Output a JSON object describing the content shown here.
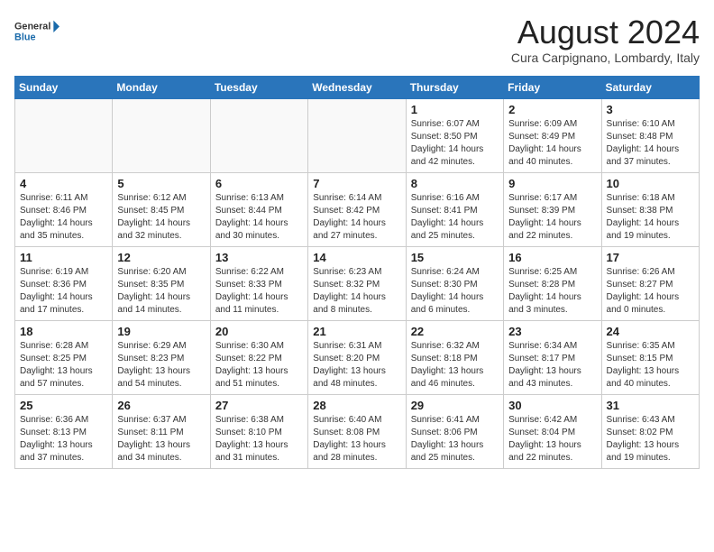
{
  "header": {
    "logo_general": "General",
    "logo_blue": "Blue",
    "month_title": "August 2024",
    "location": "Cura Carpignano, Lombardy, Italy"
  },
  "weekdays": [
    "Sunday",
    "Monday",
    "Tuesday",
    "Wednesday",
    "Thursday",
    "Friday",
    "Saturday"
  ],
  "weeks": [
    [
      {
        "day": "",
        "info": ""
      },
      {
        "day": "",
        "info": ""
      },
      {
        "day": "",
        "info": ""
      },
      {
        "day": "",
        "info": ""
      },
      {
        "day": "1",
        "info": "Sunrise: 6:07 AM\nSunset: 8:50 PM\nDaylight: 14 hours\nand 42 minutes."
      },
      {
        "day": "2",
        "info": "Sunrise: 6:09 AM\nSunset: 8:49 PM\nDaylight: 14 hours\nand 40 minutes."
      },
      {
        "day": "3",
        "info": "Sunrise: 6:10 AM\nSunset: 8:48 PM\nDaylight: 14 hours\nand 37 minutes."
      }
    ],
    [
      {
        "day": "4",
        "info": "Sunrise: 6:11 AM\nSunset: 8:46 PM\nDaylight: 14 hours\nand 35 minutes."
      },
      {
        "day": "5",
        "info": "Sunrise: 6:12 AM\nSunset: 8:45 PM\nDaylight: 14 hours\nand 32 minutes."
      },
      {
        "day": "6",
        "info": "Sunrise: 6:13 AM\nSunset: 8:44 PM\nDaylight: 14 hours\nand 30 minutes."
      },
      {
        "day": "7",
        "info": "Sunrise: 6:14 AM\nSunset: 8:42 PM\nDaylight: 14 hours\nand 27 minutes."
      },
      {
        "day": "8",
        "info": "Sunrise: 6:16 AM\nSunset: 8:41 PM\nDaylight: 14 hours\nand 25 minutes."
      },
      {
        "day": "9",
        "info": "Sunrise: 6:17 AM\nSunset: 8:39 PM\nDaylight: 14 hours\nand 22 minutes."
      },
      {
        "day": "10",
        "info": "Sunrise: 6:18 AM\nSunset: 8:38 PM\nDaylight: 14 hours\nand 19 minutes."
      }
    ],
    [
      {
        "day": "11",
        "info": "Sunrise: 6:19 AM\nSunset: 8:36 PM\nDaylight: 14 hours\nand 17 minutes."
      },
      {
        "day": "12",
        "info": "Sunrise: 6:20 AM\nSunset: 8:35 PM\nDaylight: 14 hours\nand 14 minutes."
      },
      {
        "day": "13",
        "info": "Sunrise: 6:22 AM\nSunset: 8:33 PM\nDaylight: 14 hours\nand 11 minutes."
      },
      {
        "day": "14",
        "info": "Sunrise: 6:23 AM\nSunset: 8:32 PM\nDaylight: 14 hours\nand 8 minutes."
      },
      {
        "day": "15",
        "info": "Sunrise: 6:24 AM\nSunset: 8:30 PM\nDaylight: 14 hours\nand 6 minutes."
      },
      {
        "day": "16",
        "info": "Sunrise: 6:25 AM\nSunset: 8:28 PM\nDaylight: 14 hours\nand 3 minutes."
      },
      {
        "day": "17",
        "info": "Sunrise: 6:26 AM\nSunset: 8:27 PM\nDaylight: 14 hours\nand 0 minutes."
      }
    ],
    [
      {
        "day": "18",
        "info": "Sunrise: 6:28 AM\nSunset: 8:25 PM\nDaylight: 13 hours\nand 57 minutes."
      },
      {
        "day": "19",
        "info": "Sunrise: 6:29 AM\nSunset: 8:23 PM\nDaylight: 13 hours\nand 54 minutes."
      },
      {
        "day": "20",
        "info": "Sunrise: 6:30 AM\nSunset: 8:22 PM\nDaylight: 13 hours\nand 51 minutes."
      },
      {
        "day": "21",
        "info": "Sunrise: 6:31 AM\nSunset: 8:20 PM\nDaylight: 13 hours\nand 48 minutes."
      },
      {
        "day": "22",
        "info": "Sunrise: 6:32 AM\nSunset: 8:18 PM\nDaylight: 13 hours\nand 46 minutes."
      },
      {
        "day": "23",
        "info": "Sunrise: 6:34 AM\nSunset: 8:17 PM\nDaylight: 13 hours\nand 43 minutes."
      },
      {
        "day": "24",
        "info": "Sunrise: 6:35 AM\nSunset: 8:15 PM\nDaylight: 13 hours\nand 40 minutes."
      }
    ],
    [
      {
        "day": "25",
        "info": "Sunrise: 6:36 AM\nSunset: 8:13 PM\nDaylight: 13 hours\nand 37 minutes."
      },
      {
        "day": "26",
        "info": "Sunrise: 6:37 AM\nSunset: 8:11 PM\nDaylight: 13 hours\nand 34 minutes."
      },
      {
        "day": "27",
        "info": "Sunrise: 6:38 AM\nSunset: 8:10 PM\nDaylight: 13 hours\nand 31 minutes."
      },
      {
        "day": "28",
        "info": "Sunrise: 6:40 AM\nSunset: 8:08 PM\nDaylight: 13 hours\nand 28 minutes."
      },
      {
        "day": "29",
        "info": "Sunrise: 6:41 AM\nSunset: 8:06 PM\nDaylight: 13 hours\nand 25 minutes."
      },
      {
        "day": "30",
        "info": "Sunrise: 6:42 AM\nSunset: 8:04 PM\nDaylight: 13 hours\nand 22 minutes."
      },
      {
        "day": "31",
        "info": "Sunrise: 6:43 AM\nSunset: 8:02 PM\nDaylight: 13 hours\nand 19 minutes."
      }
    ]
  ]
}
